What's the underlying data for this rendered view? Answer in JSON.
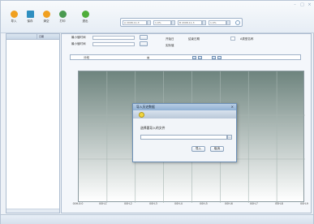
{
  "toolbar": {
    "buttons": [
      {
        "label": "导入",
        "icon": "import-icon",
        "color": "#f0a020"
      },
      {
        "label": "保存",
        "icon": "save-icon",
        "color": "#2f8fc0"
      },
      {
        "label": "清空",
        "icon": "clear-icon",
        "color": "#f0a020"
      },
      {
        "label": "打印",
        "icon": "print-icon",
        "color": "#4a9a50"
      },
      {
        "label": "退出",
        "icon": "exit-icon",
        "color": "#4fae3a"
      }
    ],
    "controls": {
      "item1": "A 2008-11-3",
      "item2": "1.0%",
      "item3": "B 2008-11-3",
      "item4": "1.0%"
    }
  },
  "sidebar": {
    "col1": "",
    "col2": "日期"
  },
  "form": {
    "label_start": "最小值时间",
    "label_end": "最小值时间",
    "label_a": "开始日",
    "label_b": "结束日期",
    "label_c": "实际值",
    "label_d": "A类型名称",
    "segment_label": "分段"
  },
  "plot": {
    "ylabel": "",
    "x_labels": [
      "00H-0:0",
      "00H-1",
      "00H-2",
      "00H-3",
      "00H-4",
      "00H-5",
      "00H-6",
      "00H-7",
      "00H-8",
      "00H-9"
    ]
  },
  "dialog": {
    "title": "导入历史数据",
    "close": "×",
    "prompt": "选择要导入的文件",
    "browse": "…",
    "ok": "导入",
    "cancel": "取消"
  },
  "colors": {
    "accent": "#6c8fb7",
    "plot_top": "#6e847e"
  }
}
